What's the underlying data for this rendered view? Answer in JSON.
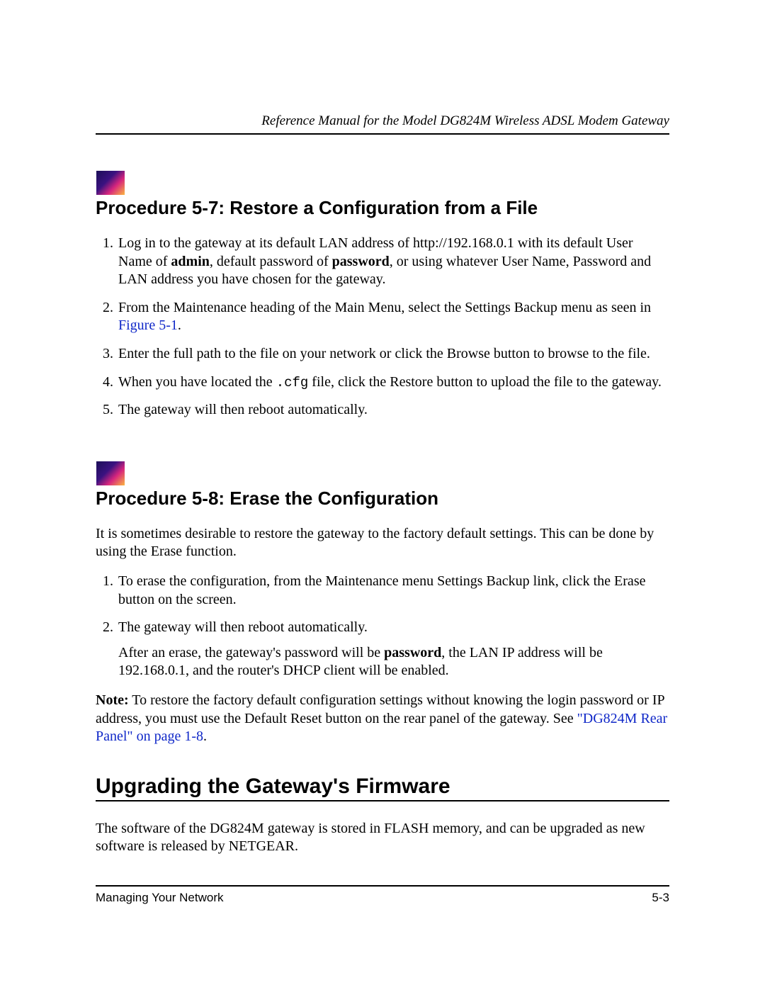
{
  "header": {
    "title": "Reference Manual for the Model DG824M Wireless ADSL Modem Gateway"
  },
  "proc1": {
    "title": "Procedure 5-7:  Restore a Configuration from a File",
    "step1_a": "Log in to the gateway at its default LAN address of http://192.168.0.1 with its default User Name of ",
    "step1_b_bold": "admin",
    "step1_c": ", default password of ",
    "step1_d_bold": "password",
    "step1_e": ", or using whatever User Name, Password and LAN address you have chosen for the gateway.",
    "step2_a": "From the Maintenance heading of the Main Menu, select the Settings Backup menu as seen in ",
    "step2_link": "Figure 5-1",
    "step2_b": ".",
    "step3": "Enter the full path to the file on your network or click the Browse button to browse to the file.",
    "step4_a": "When you have located the ",
    "step4_mono": ".cfg",
    "step4_b": " file, click the Restore button to upload the file to the gateway.",
    "step5": "The gateway will then reboot automatically."
  },
  "proc2": {
    "title": "Procedure 5-8:  Erase the Configuration",
    "intro": "It is sometimes desirable to restore the gateway to the factory default settings. This can be done by using the Erase function.",
    "step1": "To erase the configuration, from the Maintenance menu Settings Backup link, click the Erase button on the screen.",
    "step2": "The gateway will then reboot automatically.",
    "step2_sub_a": "After an erase, the gateway's password will be ",
    "step2_sub_bold": "password",
    "step2_sub_b": ", the LAN IP address will be 192.168.0.1, and the router's DHCP client will be enabled.",
    "note_label": "Note:",
    "note_a": " To restore the factory default configuration settings without knowing the login password or IP address, you must use the Default Reset button on the rear panel of the gateway. See ",
    "note_link": "\"DG824M Rear Panel\" on page 1-8",
    "note_b": "."
  },
  "section": {
    "title": "Upgrading the Gateway's Firmware",
    "body": "The software of the DG824M gateway is stored in FLASH memory, and can be upgraded as new software is released by NETGEAR."
  },
  "footer": {
    "left": "Managing Your Network",
    "right": "5-3"
  }
}
